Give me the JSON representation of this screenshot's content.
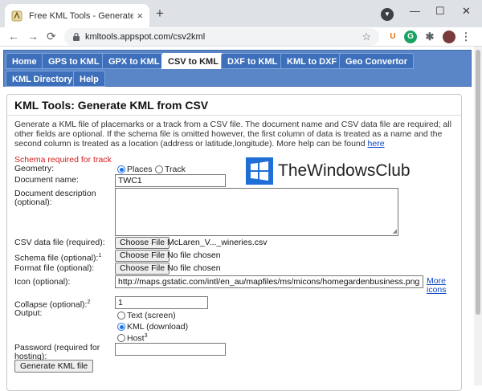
{
  "browser": {
    "tab_title": "Free KML Tools - Generate KML f",
    "tab_close": "×",
    "new_tab": "+",
    "url": "kmltools.appspot.com/csv2kml",
    "back": "←",
    "forward": "→",
    "reload": "⟳",
    "minimize": "—",
    "maximize": "☐",
    "close": "✕"
  },
  "nav": {
    "tabs": [
      {
        "label": "Home"
      },
      {
        "label": "GPS to KML"
      },
      {
        "label": "GPX to KML"
      },
      {
        "label": "CSV to KML"
      },
      {
        "label": "DXF to KML"
      },
      {
        "label": "KML to DXF"
      },
      {
        "label": "Geo Convertor"
      },
      {
        "label": "KML Directory"
      },
      {
        "label": "Help"
      }
    ],
    "active_tab": "CSV to KML"
  },
  "page": {
    "heading": "KML Tools: Generate KML from CSV",
    "intro": "Generate a KML file of placemarks or a track from a CSV file. The document name and CSV data file are required; all other fields are optional. If the schema file is omitted however, the first column of data is treated as a name and the second column is treated as a location (address or latitude,longitude). More help can be found",
    "intro_link": "here",
    "schema_note": "Schema required for track"
  },
  "form": {
    "geometry_label": "Geometry:",
    "geometry_options": [
      "Places",
      "Track"
    ],
    "geometry_selected": "Places",
    "docname_label": "Document name:",
    "docname_value": "TWC1",
    "docdesc_label": "Document description (optional):",
    "csv_label": "CSV data file (required):",
    "csv_file": "McLaren_V..._wineries.csv",
    "schema_label": "Schema file (optional):",
    "schema_sup": "1",
    "schema_file": "No file chosen",
    "format_label": "Format file (optional):",
    "format_file": "No file chosen",
    "choose_file": "Choose File",
    "icon_label": "Icon (optional):",
    "icon_value": "http://maps.gstatic.com/intl/en_au/mapfiles/ms/micons/homegardenbusiness.png",
    "more_icons": "More icons",
    "collapse_label": "Collapse (optional):",
    "collapse_sup": "2",
    "collapse_value": "1",
    "output_label": "Output:",
    "output_options": [
      "Text (screen)",
      "KML (download)",
      "Host"
    ],
    "output_host_sup": "3",
    "output_selected": "KML (download)",
    "password_label": "Password (required for hosting):",
    "submit_label": "Generate KML file"
  },
  "watermark": {
    "text": "TheWindowsClub"
  },
  "colors": {
    "nav_bg": "#5a86c8",
    "nav_tab": "#3d6fbb",
    "link": "#0b44c5",
    "note_red": "#d42020"
  }
}
